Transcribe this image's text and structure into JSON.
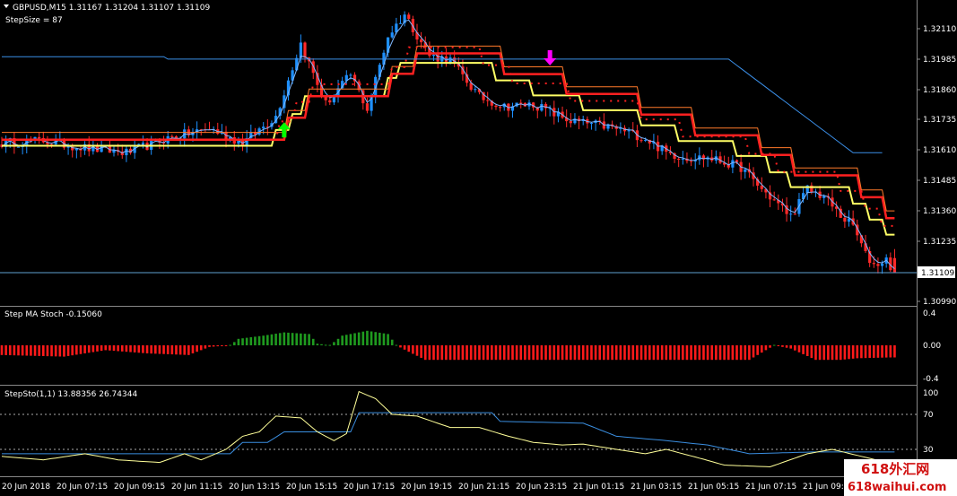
{
  "window": {
    "symbol_line": "GBPUSD,M15  1.31167 1.31204 1.31107 1.31109",
    "step_size": "StepSize = 87"
  },
  "panels": {
    "indicator1_label": "Step MA Stoch -0.15060",
    "indicator2_label": "StepSto(1,1) 13.88356 26.74344"
  },
  "price_axis": {
    "ticks": [
      "1.32110",
      "1.31985",
      "1.31860",
      "1.31735",
      "1.31610",
      "1.31485",
      "1.31360",
      "1.31235",
      "1.31109",
      "1.30990"
    ],
    "current_price": "1.31109"
  },
  "ind1_axis": {
    "ticks": [
      "0.4",
      "0.00",
      "-0.4"
    ]
  },
  "ind2_axis": {
    "ticks": [
      "100",
      "70",
      "30"
    ]
  },
  "time_axis": {
    "labels": [
      "20 Jun 2018",
      "20 Jun 07:15",
      "20 Jun 09:15",
      "20 Jun 11:15",
      "20 Jun 13:15",
      "20 Jun 15:15",
      "20 Jun 17:15",
      "20 Jun 19:15",
      "20 Jun 21:15",
      "20 Jun 23:15",
      "21 Jun 01:15",
      "21 Jun 03:15",
      "21 Jun 05:15",
      "21 Jun 07:15",
      "21 Jun 09:1"
    ]
  },
  "watermark": {
    "line1": "618外汇网",
    "line2": "618waihui.com"
  },
  "colors": {
    "bull_candle": "#1e90ff",
    "bear_candle": "#ff2a2a",
    "thin_line": "#3b8fe8",
    "yellow_band": "#ffff66",
    "red_band": "#ff2020",
    "orange_line": "#ff7a2a",
    "buy_arrow": "#00ff00",
    "sell_arrow": "#ff00ff",
    "hist_pos": "#1f9a1f",
    "hist_neg": "#ff1a1a",
    "stoch_main": "#ffff99",
    "stoch_signal": "#3a8ee0"
  },
  "chart_data": {
    "type": "candlestick",
    "symbol": "GBPUSD",
    "timeframe": "M15",
    "ohlc_last": {
      "open": 1.31167,
      "high": 1.31204,
      "low": 1.31107,
      "close": 1.31109
    },
    "ylim": [
      1.3094,
      1.3224
    ],
    "close_path": [
      [
        0,
        1.3164
      ],
      [
        10,
        1.3165
      ],
      [
        20,
        1.3162
      ],
      [
        30,
        1.316
      ],
      [
        40,
        1.3166
      ],
      [
        50,
        1.317
      ],
      [
        58,
        1.3164
      ],
      [
        66,
        1.3175
      ],
      [
        72,
        1.3205
      ],
      [
        78,
        1.318
      ],
      [
        84,
        1.3192
      ],
      [
        88,
        1.3178
      ],
      [
        93,
        1.3208
      ],
      [
        97,
        1.3217
      ],
      [
        103,
        1.32
      ],
      [
        108,
        1.3198
      ],
      [
        115,
        1.3183
      ],
      [
        121,
        1.3179
      ],
      [
        128,
        1.318
      ],
      [
        137,
        1.3173
      ],
      [
        145,
        1.3171
      ],
      [
        150,
        1.3169
      ],
      [
        155,
        1.3166
      ],
      [
        160,
        1.316
      ],
      [
        165,
        1.3158
      ],
      [
        170,
        1.3158
      ],
      [
        178,
        1.3154
      ],
      [
        183,
        1.3145
      ],
      [
        190,
        1.3134
      ],
      [
        194,
        1.3145
      ],
      [
        198,
        1.3142
      ],
      [
        202,
        1.3134
      ],
      [
        205,
        1.313
      ],
      [
        208,
        1.3118
      ],
      [
        210,
        1.3114
      ],
      [
        213,
        1.3116
      ],
      [
        215,
        1.3111
      ]
    ],
    "price_channel": {
      "level": 1.31985,
      "start_bar": 40,
      "end_bar": 175,
      "drop_to": 1.316
    },
    "signals": [
      {
        "type": "buy",
        "bar": 68
      },
      {
        "type": "sell",
        "bar": 132
      }
    ],
    "indicator1": {
      "name": "Step MA Stoch",
      "value": -0.1506,
      "ylim": [
        -0.5,
        0.5
      ],
      "series": [
        [
          0,
          -0.12
        ],
        [
          15,
          -0.14
        ],
        [
          25,
          -0.06
        ],
        [
          35,
          -0.1
        ],
        [
          45,
          -0.12
        ],
        [
          50,
          -0.02
        ],
        [
          55,
          0.0
        ],
        [
          57,
          0.08
        ],
        [
          63,
          0.12
        ],
        [
          68,
          0.16
        ],
        [
          74,
          0.14
        ],
        [
          76,
          0.02
        ],
        [
          79,
          0.0
        ],
        [
          82,
          0.12
        ],
        [
          88,
          0.18
        ],
        [
          93,
          0.14
        ],
        [
          95,
          0.0
        ],
        [
          98,
          -0.08
        ],
        [
          102,
          -0.18
        ],
        [
          140,
          -0.18
        ],
        [
          180,
          -0.18
        ],
        [
          186,
          0.0
        ],
        [
          190,
          -0.04
        ],
        [
          196,
          -0.18
        ],
        [
          202,
          -0.18
        ],
        [
          206,
          -0.16
        ],
        [
          214,
          -0.15
        ]
      ]
    },
    "indicator2": {
      "name": "StepSto(1,1)",
      "main": 13.88356,
      "signal": 26.74344,
      "ylim": [
        0,
        105
      ],
      "levels": [
        70,
        30
      ],
      "main_series": [
        [
          0,
          22
        ],
        [
          10,
          18
        ],
        [
          20,
          25
        ],
        [
          28,
          18
        ],
        [
          38,
          15
        ],
        [
          44,
          25
        ],
        [
          48,
          18
        ],
        [
          54,
          30
        ],
        [
          58,
          45
        ],
        [
          62,
          50
        ],
        [
          66,
          68
        ],
        [
          72,
          66
        ],
        [
          76,
          50
        ],
        [
          80,
          40
        ],
        [
          83,
          48
        ],
        [
          86,
          96
        ],
        [
          90,
          88
        ],
        [
          94,
          70
        ],
        [
          100,
          68
        ],
        [
          108,
          55
        ],
        [
          115,
          55
        ],
        [
          122,
          45
        ],
        [
          128,
          38
        ],
        [
          135,
          35
        ],
        [
          140,
          36
        ],
        [
          148,
          30
        ],
        [
          155,
          25
        ],
        [
          160,
          30
        ],
        [
          168,
          20
        ],
        [
          174,
          12
        ],
        [
          185,
          10
        ],
        [
          194,
          25
        ],
        [
          200,
          30
        ],
        [
          214,
          14
        ]
      ],
      "signal_series": [
        [
          0,
          25
        ],
        [
          55,
          25
        ],
        [
          58,
          38
        ],
        [
          64,
          38
        ],
        [
          68,
          50
        ],
        [
          84,
          50
        ],
        [
          86,
          72
        ],
        [
          118,
          72
        ],
        [
          120,
          62
        ],
        [
          140,
          60
        ],
        [
          148,
          45
        ],
        [
          160,
          40
        ],
        [
          170,
          35
        ],
        [
          180,
          25
        ],
        [
          195,
          27
        ],
        [
          214,
          27
        ]
      ]
    }
  }
}
